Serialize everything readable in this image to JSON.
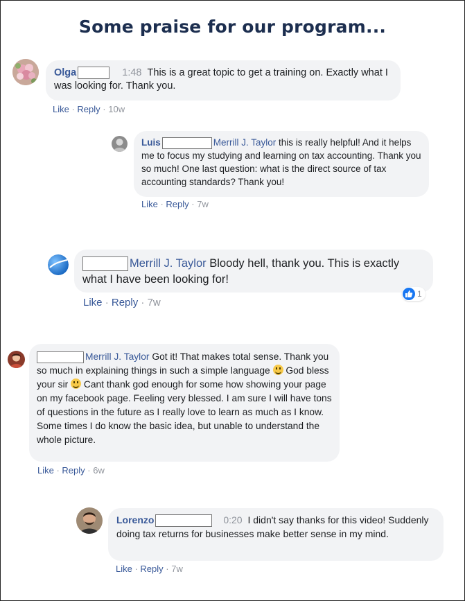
{
  "page_title": "Some praise for our program...",
  "colors": {
    "title": "#1c2e4f",
    "name_link": "#385898",
    "bubble_bg": "#f2f3f5",
    "meta": "#90949c",
    "like_blue": "#1877f2"
  },
  "comments": [
    {
      "name": "Olga",
      "timestamp": "1:48",
      "text": "This is a great topic to get a training on. Exactly what I was looking for. Thank you.",
      "actions": {
        "like": "Like",
        "reply": "Reply",
        "age": "10w"
      },
      "avatar_icon": "flower-avatar-icon"
    },
    {
      "name": "Luis",
      "mention": "Merrill J. Taylor",
      "text": "this is really helpful! And it helps me to focus my studying and learning on tax accounting. Thank you so much! One last question: what is the direct source of tax accounting standards? Thank you!",
      "actions": {
        "like": "Like",
        "reply": "Reply",
        "age": "7w"
      },
      "avatar_icon": "person-avatar-icon"
    },
    {
      "mention": "Merrill J. Taylor",
      "text": "Bloody hell, thank you. This is exactly what I have been looking for!",
      "actions": {
        "like": "Like",
        "reply": "Reply",
        "age": "7w"
      },
      "reaction_count": "1",
      "avatar_icon": "globe-avatar-icon"
    },
    {
      "mention": "Merrill J. Taylor",
      "text_part1": "Got it! That makes total sense. Thank you so much in explaining things in such a simple language",
      "text_part2": "God bless your sir",
      "text_part3": "Cant thank god enough for some how showing your page on my facebook page. Feeling very blessed. I am sure I will have tons of questions in the future as I really love to learn as much as I know. Some times I do know the basic idea, but unable to understand the whole picture.",
      "actions": {
        "like": "Like",
        "reply": "Reply",
        "age": "6w"
      },
      "avatar_icon": "person-avatar-icon"
    },
    {
      "name": "Lorenzo",
      "timestamp": "0:20",
      "text": "I didn't say thanks for this video! Suddenly doing tax returns for businesses make better sense in my mind.",
      "actions": {
        "like": "Like",
        "reply": "Reply",
        "age": "7w"
      },
      "avatar_icon": "person-avatar-icon"
    }
  ]
}
